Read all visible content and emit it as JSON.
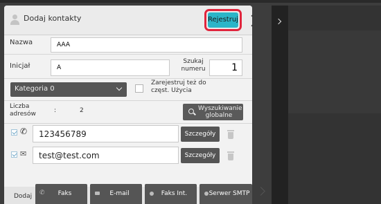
{
  "header": {
    "title": "Dodaj kontakty",
    "register_label": "Rejestruj",
    "accent": "#2bb5c8",
    "highlight": "#e0243c"
  },
  "form": {
    "name_label": "Nazwa",
    "name_value": "AAA",
    "initial_label": "Inicjał",
    "initial_value": "A",
    "search_number_label": "Szukaj numeru",
    "search_number_value": "1",
    "category_value": "Kategoria 0",
    "register_frequent_label": "Zarejestruj też do częst. Użycia"
  },
  "address": {
    "count_label": "Liczba adresów",
    "count_separator": ":",
    "count_value": "2",
    "global_search_label": "Wyszukiwanie globalne"
  },
  "entries": [
    {
      "icon": "phone-icon",
      "value": "123456789",
      "details_label": "Szczegóły"
    },
    {
      "icon": "mail-icon",
      "value": "test@test.com",
      "details_label": "Szczegóły"
    }
  ],
  "footer": {
    "add_label": "Dodaj",
    "tabs": [
      "Faks",
      "E-mail",
      "Faks Int.",
      "Serwer SMTP"
    ]
  }
}
